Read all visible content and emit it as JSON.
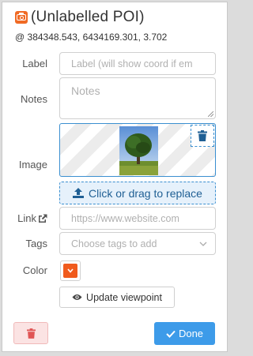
{
  "header": {
    "title": "(Unlabelled POI)",
    "coords": "@ 384348.543, 6434169.301, 3.702",
    "icon": "camera-icon"
  },
  "fields": {
    "label": {
      "label": "Label",
      "placeholder": "Label (will show coord if em"
    },
    "notes": {
      "label": "Notes",
      "placeholder": "Notes"
    },
    "image": {
      "label": "Image",
      "dropzone_text": "Click or drag to replace"
    },
    "link": {
      "label": "Link",
      "placeholder": "https://www.website.com"
    },
    "tags": {
      "label": "Tags",
      "placeholder": "Choose tags to add"
    },
    "color": {
      "label": "Color",
      "value": "#f05a1c"
    }
  },
  "buttons": {
    "update_viewpoint": "Update viewpoint",
    "done": "Done"
  },
  "colors": {
    "accent": "#3d9be9",
    "camera": "#f06a24",
    "danger": "#e05555"
  }
}
